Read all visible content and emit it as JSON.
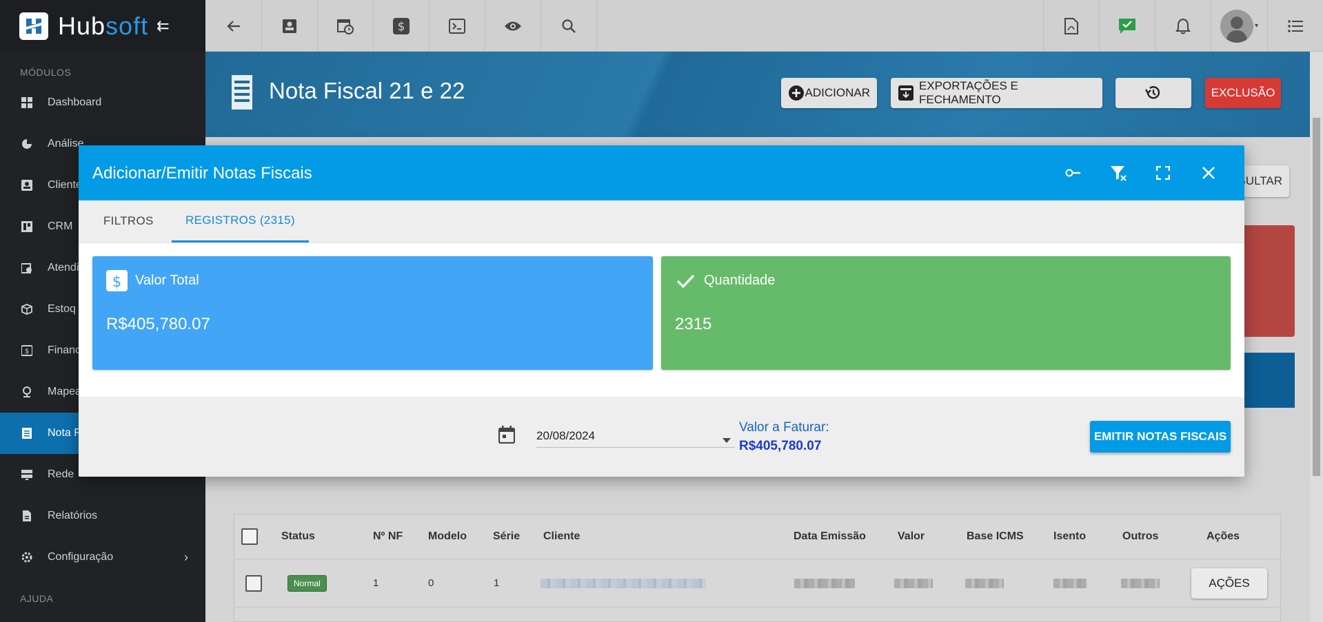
{
  "brand": {
    "part1": "Hub",
    "part2": "soft"
  },
  "sidebar": {
    "section_modules": "MÓDULOS",
    "section_help": "AJUDA",
    "items": [
      {
        "label": "Dashboard",
        "icon": "grid-icon"
      },
      {
        "label": "Análise",
        "icon": "pie-chart-icon"
      },
      {
        "label": "Clientes",
        "icon": "contact-icon"
      },
      {
        "label": "CRM",
        "icon": "kanban-icon"
      },
      {
        "label": "Atendimento",
        "icon": "calendar-clock-icon"
      },
      {
        "label": "Estoque",
        "icon": "box-icon"
      },
      {
        "label": "Financeiro",
        "icon": "dollar-icon"
      },
      {
        "label": "Mapeamento",
        "icon": "map-pin-icon"
      },
      {
        "label": "Nota Fiscal",
        "icon": "receipt-icon"
      },
      {
        "label": "Rede",
        "icon": "server-icon"
      },
      {
        "label": "Relatórios",
        "icon": "document-icon"
      },
      {
        "label": "Configuração",
        "icon": "gear-icon"
      }
    ],
    "visible_labels": [
      "Dashboard",
      "Análise",
      "Cliente",
      "CRM",
      "Atendi",
      "Estoq",
      "Financ",
      "Mapea",
      "Nota F",
      "Rede",
      "Relatórios",
      "Configuração"
    ]
  },
  "topbar": {
    "left_icons": [
      "back-arrow-icon",
      "contact-card-icon",
      "calendar-clock-icon",
      "dollar-icon",
      "terminal-icon",
      "eye-icon",
      "search-icon"
    ],
    "right_icons": [
      "pdf-icon",
      "chat-check-icon",
      "bell-icon",
      "avatar",
      "list-menu-icon"
    ]
  },
  "header": {
    "title": "Nota Fiscal 21 e 22",
    "buttons": {
      "add": "ADICIONAR",
      "export": "EXPORTAÇÕES E FECHAMENTO",
      "delete": "EXCLUSÃO"
    }
  },
  "background": {
    "consult_btn": "SULTAR"
  },
  "modal": {
    "title": "Adicionar/Emitir Notas Fiscais",
    "tabs": {
      "filters": "FILTROS",
      "records": "REGISTROS (2315)"
    },
    "cards": {
      "total_label": "Valor Total",
      "total_value": "R$405,780.07",
      "qty_label": "Quantidade",
      "qty_value": "2315"
    },
    "footer": {
      "date": "20/08/2024",
      "faturar_label": "Valor a Faturar:",
      "faturar_value": "R$405,780.07",
      "emit_button": "EMITIR NOTAS FISCAIS"
    }
  },
  "table": {
    "columns": [
      "Status",
      "Nº NF",
      "Modelo",
      "Série",
      "Cliente",
      "Data Emissão",
      "Valor",
      "Base ICMS",
      "Isento",
      "Outros",
      "Ações"
    ],
    "rows": [
      {
        "status": "Normal",
        "nf": "1",
        "modelo": "0",
        "serie": "1",
        "acoes": "AÇÕES"
      }
    ]
  },
  "colors": {
    "accent": "#039be5",
    "sidebar_bg": "#202225",
    "active_item": "#0d6fae",
    "card_blue": "#42a5f5",
    "card_green": "#66bb6a",
    "danger": "#d63a35"
  }
}
